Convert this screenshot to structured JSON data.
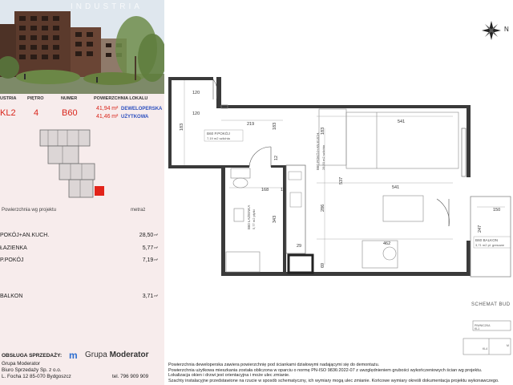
{
  "hero": {
    "brand": "INDUSTRIA",
    "colors": {
      "sky": "#dfe7ee",
      "building": "#5b3a2c",
      "trees": "#6e8c4a"
    }
  },
  "specs": {
    "headers": {
      "building": "USTRIA",
      "floor": "PIĘTRO",
      "number": "NUMER",
      "area": "POWIERZCHNIA LOKALU"
    },
    "building": "KL2",
    "floor": "4",
    "number": "B60",
    "area_dev": {
      "value": "41,94",
      "unit": "m²",
      "label": "DEWELOPERSKA"
    },
    "area_use": {
      "value": "41,46",
      "unit": "m²",
      "label": "UŻYTKOWA"
    }
  },
  "rooms": {
    "header_left": "Powierzchnia wg projektu",
    "header_right": "metraż",
    "items": [
      {
        "name": "POKÓJ+AN.KUCH.",
        "value": "28,50",
        "unit": "m²"
      },
      {
        "name": "ŁAZIENKA",
        "value": "5,77",
        "unit": "m²"
      },
      {
        "name": "P.POKÓJ",
        "value": "7,19",
        "unit": "m²"
      },
      {
        "name": "BALKON",
        "value": "3,71",
        "unit": "m²"
      }
    ]
  },
  "footer": {
    "service": "OBSŁUGA SPRZEDAŻY:",
    "company": "Grupa Moderator",
    "office": "Biuro Sprzedaży Sp. z o.o.",
    "address": "L. Focha 12 85-070 Bydgoszcz",
    "phone": "tel. 796 909 909",
    "logo_mark": "m",
    "logo_light": "Grupa",
    "logo_bold": "Moderator"
  },
  "plan": {
    "compass_label": "N",
    "dims": {
      "d120a": "120",
      "d120b": "120",
      "d183a": "183",
      "d219": "219",
      "d183b": "183",
      "d183c": "183",
      "d541a": "541",
      "d541b": "541",
      "d537": "537",
      "d12": "12",
      "d168": "168",
      "d10": "10",
      "d343": "343",
      "d286": "286",
      "d29": "29",
      "d69": "69",
      "d462": "462",
      "d150": "150",
      "d247": "247"
    },
    "labels": {
      "hall": "B60    P.POKÓJ",
      "hall_area": "7,19 m2  szlichta",
      "room": "B60    POKÓJ+AN.KUCH.",
      "room_area": "28,50 m2  szlichta",
      "bath": "B60    ŁAZIENKA",
      "bath_area": "5,77 m2  płytki",
      "balcony": "B60    BALKON",
      "balcony_area": "3,71 m2  pł. gresowe"
    },
    "schema": "SCHEMAT BUD",
    "schema_tags": {
      "a": "PIWNICZKA",
      "b": "KL1",
      "c": "KL4",
      "d": "M"
    }
  },
  "notes": [
    "Powierzchnia deweloperska zawiera powierzchnię pod ściankami działowymi nadającymi się do demontażu.",
    "Powierzchnia użytkowa mieszkania została obliczona w oparciu o normę  PN-ISO 9836:2022-07 z uwzględnieniem grubości wykończeniowych ścian wg projektu.",
    "Lokalizacja okien i drzwi jest orientacyjna i może ulec zmianie.",
    "Szachty instalacyjne przedstawione na rzucie w sposób schematyczny, ich wymiary mogą ulec zmianie. Końcowe wymiary określi dokumentacja projektu wykonawczego."
  ]
}
